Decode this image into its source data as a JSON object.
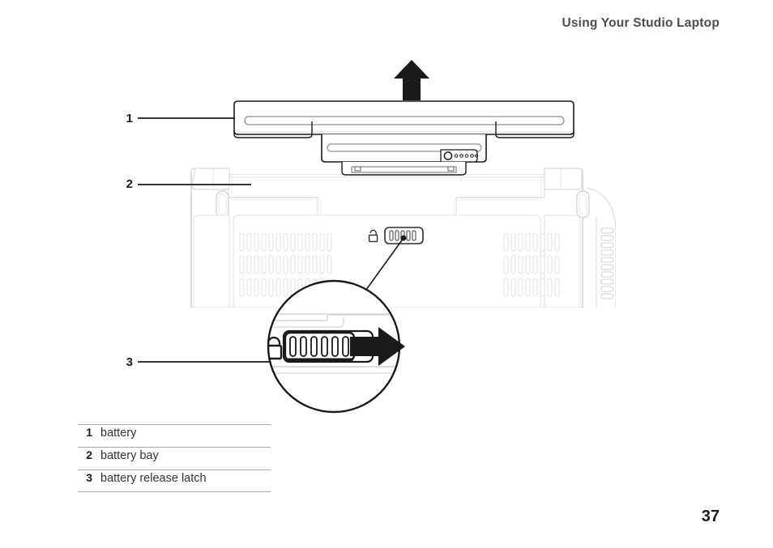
{
  "header": {
    "title": "Using Your Studio Laptop"
  },
  "figure": {
    "callouts": [
      {
        "id": "1",
        "number": "1"
      },
      {
        "id": "2",
        "number": "2"
      },
      {
        "id": "3",
        "number": "3"
      }
    ],
    "icons": {
      "up_arrow": "up-arrow-icon",
      "right_arrow": "right-arrow-icon",
      "lock_small": "lock-icon",
      "lock_magnified": "lock-icon",
      "battery_gauge_button": "battery-gauge-button-icon",
      "magnifier_circle": "magnifier-circle"
    },
    "battery_gauge": {
      "led_count": 5
    },
    "latch": {
      "ridge_count": 6
    }
  },
  "legend": {
    "rows": [
      {
        "number": "1",
        "label": "battery"
      },
      {
        "number": "2",
        "label": "battery bay"
      },
      {
        "number": "3",
        "label": "battery release latch"
      }
    ]
  },
  "footer": {
    "page_number": "37"
  },
  "colors": {
    "header_text": "#4d4d4d",
    "body_text": "#333333",
    "rule": "#a6a6a6",
    "line_dark": "#1a1a1a",
    "line_light": "#d8d8d8",
    "line_faint": "#eaeaea"
  }
}
